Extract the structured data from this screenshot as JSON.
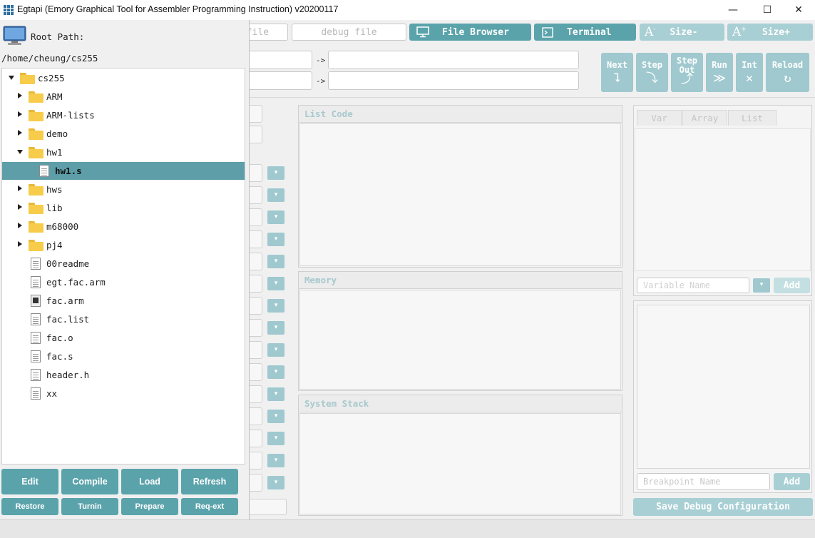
{
  "window": {
    "title": "Egtapi (Emory Graphical Tool for Assembler Programming Instruction) v20200117",
    "minimize": "—",
    "maximize": "☐",
    "close": "✕"
  },
  "toolbar": {
    "source_file_placeholder": "file",
    "debug_file_placeholder": "debug file",
    "file_browser": "File Browser",
    "terminal": "Terminal",
    "size_minus": "Size-",
    "size_plus": "Size+",
    "arrow1": "->",
    "arrow2": "->"
  },
  "debug_buttons": [
    {
      "label": "Next",
      "icon": "step-over-icon",
      "symbol": "⮧"
    },
    {
      "label": "Step",
      "icon": "step-into-icon",
      "symbol": "⤵"
    },
    {
      "label": "Step\nOut",
      "icon": "step-out-icon",
      "symbol": "⤴"
    },
    {
      "label": "Run",
      "icon": "run-icon",
      "symbol": "≫"
    },
    {
      "label": "Int",
      "icon": "interrupt-icon",
      "symbol": "✕"
    },
    {
      "label": "Reload",
      "icon": "reload-icon",
      "symbol": "↻"
    }
  ],
  "panels": {
    "list_code": "List Code",
    "memory": "Memory",
    "system_stack": "System Stack"
  },
  "var_tabs": [
    "Var",
    "Array",
    "List"
  ],
  "variable_name_placeholder": "Variable Name",
  "variable_add": "Add",
  "breakpoint_name_placeholder": "Breakpoint Name",
  "breakpoint_add": "Add",
  "save_debug_config": "Save Debug Configuration",
  "file_browser": {
    "root_label": "Root Path:",
    "root_path": "/home/cheung/cs255",
    "tree": [
      {
        "label": "cs255",
        "type": "folder",
        "depth": 0,
        "state": "open"
      },
      {
        "label": "ARM",
        "type": "folder",
        "depth": 1,
        "state": "closed"
      },
      {
        "label": "ARM-lists",
        "type": "folder",
        "depth": 1,
        "state": "closed"
      },
      {
        "label": "demo",
        "type": "folder",
        "depth": 1,
        "state": "closed"
      },
      {
        "label": "hw1",
        "type": "folder",
        "depth": 1,
        "state": "open"
      },
      {
        "label": "hw1.s",
        "type": "file",
        "depth": 2,
        "selected": true
      },
      {
        "label": "hws",
        "type": "folder",
        "depth": 1,
        "state": "closed"
      },
      {
        "label": "lib",
        "type": "folder",
        "depth": 1,
        "state": "closed"
      },
      {
        "label": "m68000",
        "type": "folder",
        "depth": 1,
        "state": "closed"
      },
      {
        "label": "pj4",
        "type": "folder",
        "depth": 1,
        "state": "closed"
      },
      {
        "label": "00readme",
        "type": "file",
        "depth": 1
      },
      {
        "label": "egt.fac.arm",
        "type": "file",
        "depth": 1
      },
      {
        "label": "fac.arm",
        "type": "file-exec",
        "depth": 1
      },
      {
        "label": "fac.list",
        "type": "file",
        "depth": 1
      },
      {
        "label": "fac.o",
        "type": "file",
        "depth": 1
      },
      {
        "label": "fac.s",
        "type": "file",
        "depth": 1
      },
      {
        "label": "header.h",
        "type": "file",
        "depth": 1
      },
      {
        "label": "xx",
        "type": "file",
        "depth": 1
      }
    ],
    "buttons_row1": [
      "Edit",
      "Compile",
      "Load",
      "Refresh"
    ],
    "buttons_row2": [
      "Restore",
      "Turnin",
      "Prepare",
      "Req-ext"
    ]
  },
  "register_rows": 15,
  "colors": {
    "accent": "#5aa3ab",
    "accent_dim": "#9fc9cf",
    "selection": "#5d9ea8",
    "folder": "#f7cc4a"
  }
}
